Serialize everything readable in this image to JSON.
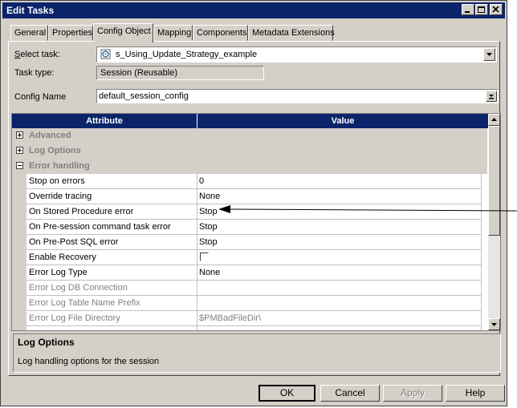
{
  "window": {
    "title": "Edit Tasks"
  },
  "tabs": [
    {
      "label": "General"
    },
    {
      "label": "Properties"
    },
    {
      "label": "Config Object",
      "active": true
    },
    {
      "label": "Mapping"
    },
    {
      "label": "Components"
    },
    {
      "label": "Metadata Extensions"
    }
  ],
  "form": {
    "select_task_label_u": "S",
    "select_task_label_rest": "elect task:",
    "select_task_value": "s_Using_Update_Strategy_example",
    "task_type_label": "Task type:",
    "task_type_value": "Session (Reusable)",
    "config_name_label": "Config Name",
    "config_name_value": "default_session_config"
  },
  "grid": {
    "headers": [
      "Attribute",
      "Value"
    ],
    "groups": [
      "Advanced",
      "Log Options",
      "Error handling"
    ],
    "rows": [
      {
        "attribute": "Stop on errors",
        "value": "0"
      },
      {
        "attribute": "Override tracing",
        "value": "None"
      },
      {
        "attribute": "On Stored Procedure error",
        "value": "Stop"
      },
      {
        "attribute": "On Pre-session command task error",
        "value": "Stop"
      },
      {
        "attribute": "On Pre-Post SQL error",
        "value": "Stop"
      },
      {
        "attribute": "Enable Recovery",
        "value": "",
        "checkbox": true,
        "checked": false
      },
      {
        "attribute": "Error Log Type",
        "value": "None"
      },
      {
        "attribute": "Error Log DB Connection",
        "value": "",
        "disabled": true
      },
      {
        "attribute": "Error Log Table Name Prefix",
        "value": "",
        "disabled": true
      },
      {
        "attribute": "Error Log File Directory",
        "value": "$PMBadFileDir\\",
        "disabled": true
      }
    ]
  },
  "description": {
    "title": "Log Options",
    "text": "Log handling options for the session"
  },
  "buttons": {
    "ok": "OK",
    "cancel": "Cancel",
    "apply": "Apply",
    "help": "Help"
  },
  "colors": {
    "titlebar": "#0a246a",
    "face": "#d4d0c8",
    "header": "#0a246a"
  }
}
